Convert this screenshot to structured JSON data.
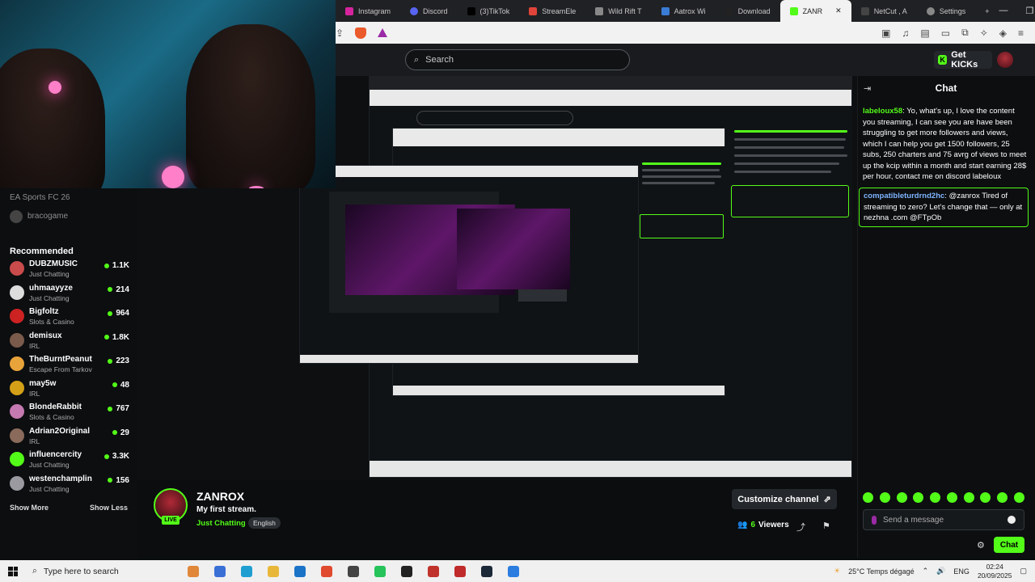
{
  "browser": {
    "tabs": [
      {
        "label": "Instagram",
        "color": "#d6249f"
      },
      {
        "label": "Discord",
        "color": "#5865f2"
      },
      {
        "label": "(3)TikTok",
        "color": "#222222"
      },
      {
        "label": "StreamEle",
        "color": "#e0443a"
      },
      {
        "label": "Wild Rift T",
        "color": "#888888"
      },
      {
        "label": "Aatrox Wi",
        "color": "#3a7bd5"
      },
      {
        "label": "Download",
        "color": "#222222"
      },
      {
        "label": "ZANR",
        "color": "#53fc18",
        "active": true
      },
      {
        "label": "NetCut , A",
        "color": "#444444"
      },
      {
        "label": "Settings",
        "color": "#888888"
      }
    ],
    "new_tab": "+",
    "controls": {
      "minimize": "—",
      "maximize": "❐",
      "close": "✕"
    }
  },
  "kick": {
    "search_placeholder": "Search",
    "get_kicks": "Get KICKs",
    "brand_color": "#53fc18"
  },
  "sidebar": {
    "top_item_category": "EA Sports FC 26",
    "top_item_name": "bracogame",
    "recommended_title": "Recommended",
    "items": [
      {
        "name": "DUBZMUSIC",
        "category": "Just Chatting",
        "viewers": "1.1K",
        "color": "#c94b4b"
      },
      {
        "name": "uhmaayyze",
        "category": "Just Chatting",
        "viewers": "214",
        "color": "#dddddd"
      },
      {
        "name": "Bigfoltz",
        "category": "Slots & Casino",
        "viewers": "964",
        "color": "#cc2222"
      },
      {
        "name": "demisux",
        "category": "IRL",
        "viewers": "1.8K",
        "color": "#7a5a4a"
      },
      {
        "name": "TheBurntPeanut",
        "category": "Escape From Tarkov",
        "viewers": "223",
        "color": "#e8a33a"
      },
      {
        "name": "may5w",
        "category": "IRL",
        "viewers": "48",
        "color": "#d4a017"
      },
      {
        "name": "BlondeRabbit",
        "category": "Slots & Casino",
        "viewers": "767",
        "color": "#c47ab0"
      },
      {
        "name": "Adrian2Original",
        "category": "IRL",
        "viewers": "29",
        "color": "#8a6a5a"
      },
      {
        "name": "influencercity",
        "category": "Just Chatting",
        "viewers": "3.3K",
        "color": "#53fc18"
      },
      {
        "name": "westenchamplin",
        "category": "Just Chatting",
        "viewers": "156",
        "color": "#9a9aa0"
      }
    ],
    "show_more": "Show More",
    "show_less": "Show Less"
  },
  "stream": {
    "streamer": "ZANROX",
    "title": "My first stream.",
    "category": "Just Chatting",
    "language": "English",
    "live": "LIVE",
    "customize": "Customize channel",
    "viewers_count": "6",
    "viewers_label": "Viewers"
  },
  "chat": {
    "title": "Chat",
    "messages": [
      {
        "user": "labeloux58",
        "text": "Yo, what's up, I love the content you streaming, I can see you are have been struggling to get more followers and views, which I can help you get 1500 followers, 25 subs, 250 charters and 75 avrg of views to meet up the kcip within a month and start earning 28$ per hour, contact me on discord labeloux"
      },
      {
        "user": "compatibleturdrnd2hc",
        "text": "@zanrox Tired of streaming to zero? Let's change that — only at nezhna .com @FTpOb"
      }
    ],
    "input_placeholder": "Send a message",
    "send": "Chat"
  },
  "taskbar": {
    "search_placeholder": "Type here to search",
    "apps": [
      "#e0873a",
      "#3a6fd6",
      "#1f9fd1",
      "#e8b73a",
      "#1a73c7",
      "#e04a2e",
      "#444444",
      "#25c35a",
      "#222222",
      "#c0332b",
      "#c02a2a",
      "#1b2838",
      "#2b7de0"
    ],
    "weather": "25°C  Temps dégagé",
    "lang": "ENG",
    "time": "02:24",
    "date": "20/09/2025"
  }
}
